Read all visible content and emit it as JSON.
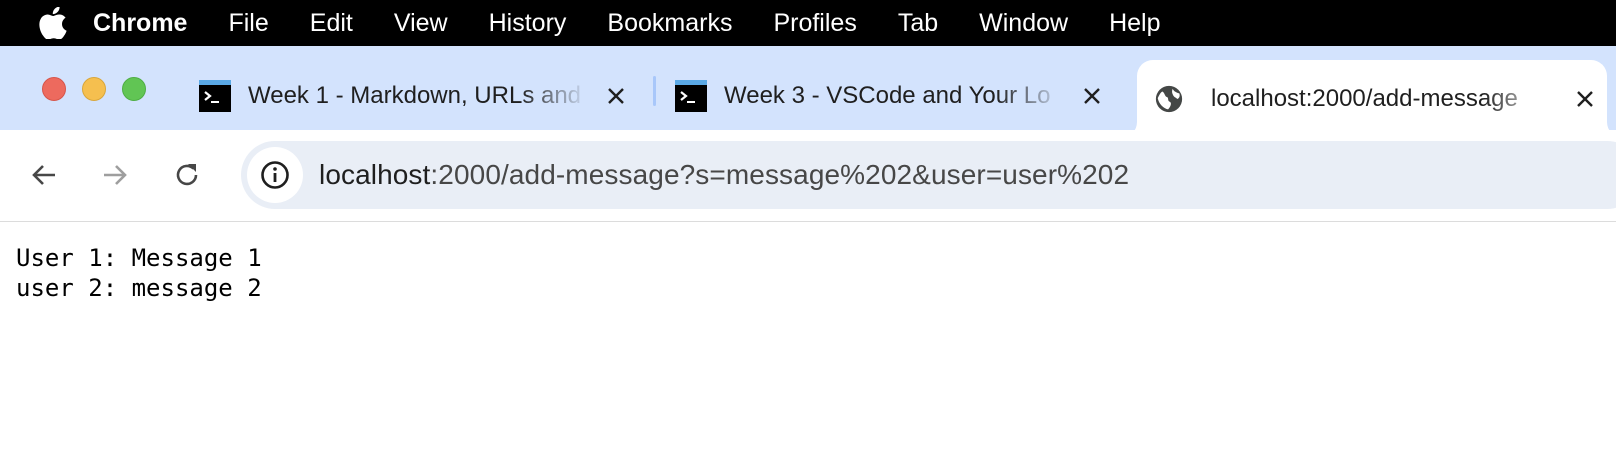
{
  "menubar": {
    "apple_icon": "apple-logo-icon",
    "items": [
      "Chrome",
      "File",
      "Edit",
      "View",
      "History",
      "Bookmarks",
      "Profiles",
      "Tab",
      "Window",
      "Help"
    ]
  },
  "tabs": [
    {
      "title": "Week 1 - Markdown, URLs and",
      "favicon": "terminal-icon",
      "active": false
    },
    {
      "title": "Week 3 - VSCode and Your Lo",
      "favicon": "terminal-icon",
      "active": false
    },
    {
      "title": "localhost:2000/add-message",
      "favicon": "globe-icon",
      "active": true
    }
  ],
  "toolbar": {
    "url_host": "localhost",
    "url_path": ":2000/add-message?s=message%202&user=user%202"
  },
  "page": {
    "lines": [
      "User 1: Message 1",
      "user 2: message 2"
    ]
  },
  "colors": {
    "menubar_bg": "#000000",
    "tabstrip_bg": "#d3e3fd",
    "omnibox_bg": "#e9eef6",
    "close_red": "#ed6a5e",
    "minimize_yellow": "#f5bf4f",
    "zoom_green": "#61c554"
  }
}
